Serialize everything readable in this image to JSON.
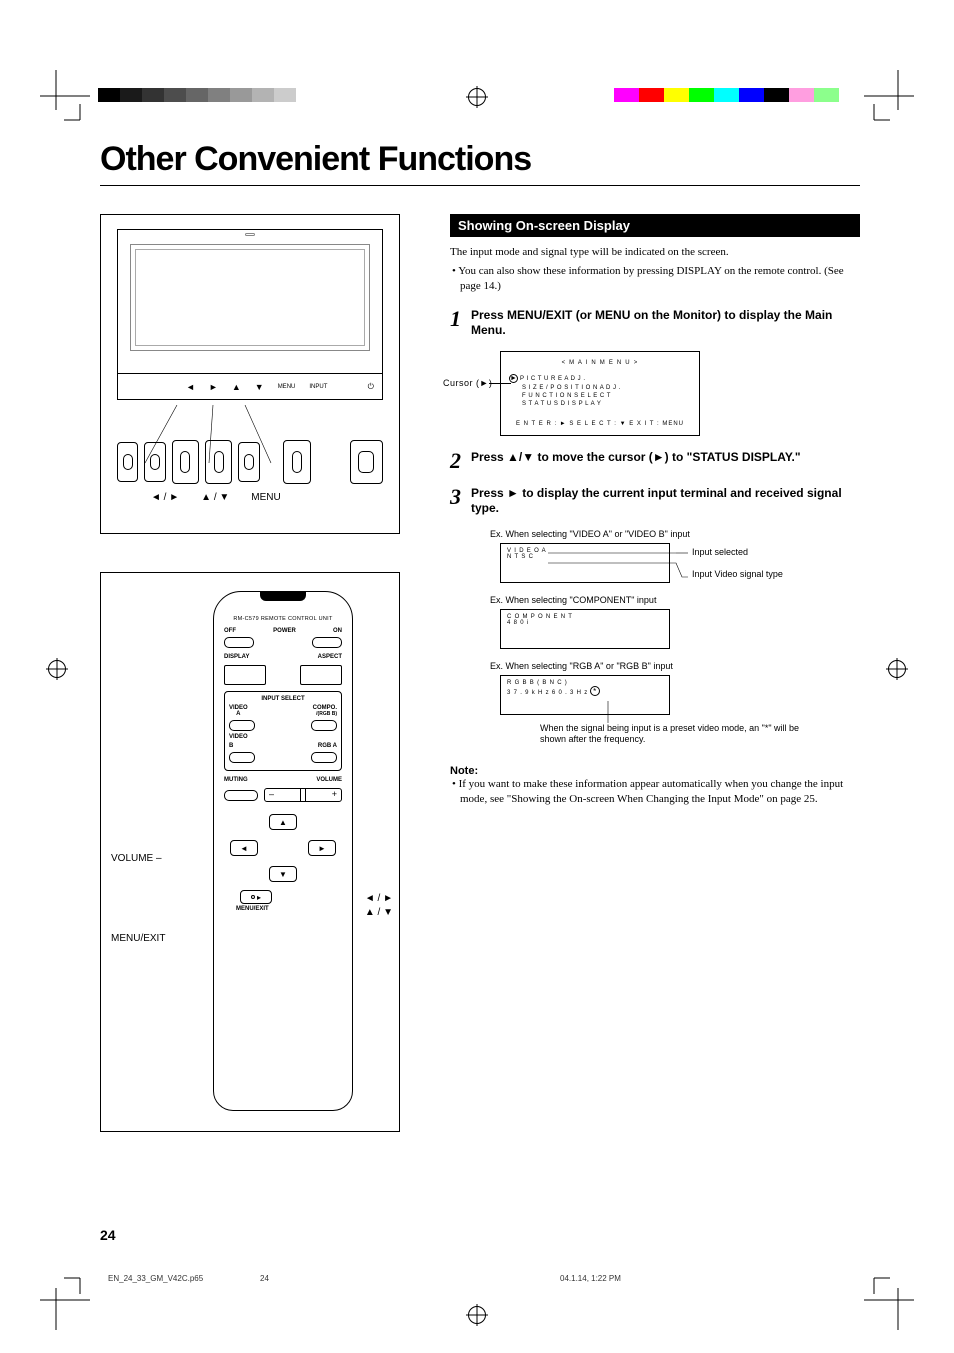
{
  "page": {
    "title": "Other Convenient Functions",
    "number": "24"
  },
  "printmarks": {
    "grayscale": [
      "#000",
      "#1a1a1a",
      "#333",
      "#4d4d4d",
      "#666",
      "#808080",
      "#999",
      "#b3b3b3",
      "#ccc"
    ],
    "colors": [
      "#ff00ff",
      "#ff0000",
      "#ffff00",
      "#00ff00",
      "#00ffff",
      "#0000ff",
      "#000000",
      "#ff66d9",
      "#66ff66"
    ]
  },
  "monitor": {
    "panel_buttons": [
      "◄",
      "►",
      "▲",
      "▼",
      "MENU",
      "INPUT"
    ],
    "labels": {
      "lr": "◄ / ►",
      "ud": "▲ / ▼",
      "menu": "MENU"
    }
  },
  "remote": {
    "model": "RM-C579  REMOTE CONTROL UNIT",
    "buttons": {
      "off": "OFF",
      "power": "POWER",
      "on": "ON",
      "display": "DISPLAY",
      "aspect": "ASPECT",
      "input_select": "INPUT SELECT",
      "video_a": "A",
      "compo": "COMPO.",
      "rgb_b_sub": "/(RGB B)",
      "video": "VIDEO",
      "video_b": "B",
      "rgb_a": "RGB A",
      "muting": "MUTING",
      "volume": "VOLUME",
      "menu_exit": "MENU/EXIT"
    },
    "pointers": {
      "volume_minus": "VOLUME –",
      "menu_exit": "MENU/EXIT",
      "lr": "◄ / ►",
      "ud": "▲ / ▼"
    }
  },
  "section": {
    "header": "Showing On-screen Display",
    "intro": "The input mode and signal type will be indicated on the screen.",
    "intro_bullet": "• You can also show these information by pressing DISPLAY on the remote control. (See page 14.)"
  },
  "steps": {
    "s1": {
      "num": "1",
      "text": "Press MENU/EXIT (or MENU on the Monitor) to display the Main Menu."
    },
    "s2": {
      "num": "2",
      "text": "Press ▲/▼ to move the cursor (►) to \"STATUS DISPLAY.\""
    },
    "s3": {
      "num": "3",
      "text": "Press ► to display the current input terminal and received signal type."
    }
  },
  "osd": {
    "cursor_label": "Cursor (►)",
    "title": "< M A I N   M E N U >",
    "items": [
      "P I C T U R E     A D J .",
      "S I Z E / P O S I T I O N     A D J .",
      "F U N C T I O N   S E L E C T",
      "S T A T U S   D I S P L A Y"
    ],
    "footer": "E N T E R : ►   S E L E C T : ▼   E X I T : MENU"
  },
  "examples": {
    "ex1_label": "Ex. When selecting \"VIDEO A\" or \"VIDEO B\" input",
    "ex1_line1": "V I D E O   A",
    "ex1_line2": "N T S C",
    "ex1_callout1": "Input selected",
    "ex1_callout2": "Input Video signal type",
    "ex2_label": "Ex. When selecting \"COMPONENT\" input",
    "ex2_line1": "C O M P O N E N T",
    "ex2_line2": "4 8 0 i",
    "ex3_label": "Ex. When selecting \"RGB A\" or \"RGB B\" input",
    "ex3_line1": "R G B   B   ( B N C )",
    "ex3_line2": "3 7 . 9 k H z       6 0 . 3 H z",
    "asterisk_note": "When the signal being input is a preset video mode, an \"*\" will be shown after the frequency."
  },
  "note": {
    "head": "Note:",
    "body": "• If you want to make these information appear automatically when you change the input mode, see \"Showing the On-screen When Changing the Input Mode\" on page 25."
  },
  "footer": {
    "file": "EN_24_33_GM_V42C.p65",
    "pg": "24",
    "stamp": "04.1.14, 1:22 PM"
  }
}
